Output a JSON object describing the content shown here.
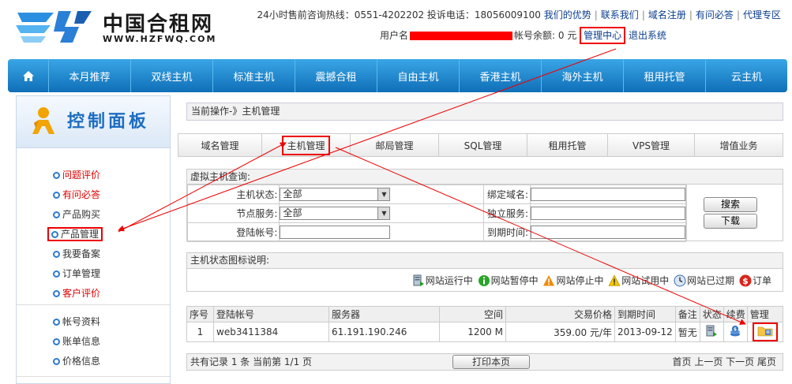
{
  "brand": {
    "title": "中国合租网",
    "url": "WWW.HZFWQ.COM"
  },
  "top_links": {
    "hotline_label": "24小时售前咨询热线：0551-4202202 投诉电话：18056009100",
    "items": [
      "我们的优势",
      "联系我们",
      "域名注册",
      "有问必答",
      "代理专区"
    ]
  },
  "account": {
    "user_prefix": "用户名",
    "balance_label": "帐号余额: 0 元",
    "manage_center": "管理中心",
    "logout": "退出系统"
  },
  "nav": {
    "items": [
      "本月推荐",
      "双线主机",
      "标准主机",
      "震撼合租",
      "自由主机",
      "香港主机",
      "海外主机",
      "租用托管",
      "云主机"
    ]
  },
  "sidebar": {
    "title": "控制面板",
    "items": [
      "问题评价",
      "有问必答",
      "产品购买",
      "产品管理",
      "我要备案",
      "订单管理",
      "客户评价"
    ],
    "items2": [
      "帐号资料",
      "账单信息",
      "价格信息"
    ]
  },
  "main": {
    "crumb": "当前操作-》主机管理",
    "tabs": [
      "域名管理",
      "主机管理",
      "邮局管理",
      "SQL管理",
      "租用托管",
      "VPS管理",
      "增值业务"
    ],
    "query": {
      "title": "虚拟主机查询:",
      "status_label": "主机状态:",
      "status_value": "全部",
      "node_label": "节点服务:",
      "node_value": "全部",
      "login_label": "登陆帐号:",
      "domain_label": "绑定域名:",
      "standalone_label": "独立服务:",
      "expire_label": "到期时间:",
      "search_btn": "搜索",
      "download_btn": "下载"
    },
    "legend": {
      "title": "主机状态图标说明:",
      "items": [
        "网站运行中",
        "网站暂停中",
        "网站停止中",
        "网站试用中",
        "网站已过期",
        "订单"
      ]
    },
    "table": {
      "headers": [
        "序号",
        "登陆帐号",
        "服务器",
        "空间",
        "交易价格",
        "到期时间",
        "备注",
        "状态",
        "续费",
        "管理"
      ],
      "rows": [
        {
          "no": "1",
          "account": "web3411384",
          "server": "61.191.190.246",
          "space": "1200 M",
          "price": "359.00 元/年",
          "expire": "2013-09-12",
          "note": "暂无"
        }
      ]
    },
    "footer": {
      "summary": "共有记录 1 条 当前第 1/1 页",
      "print": "打印本页",
      "pager": "首页 上一页 下一页 尾页"
    }
  },
  "colors": {
    "nav": "#1a82cc",
    "link": "#0a3d8f",
    "highlight": "#e00000"
  }
}
